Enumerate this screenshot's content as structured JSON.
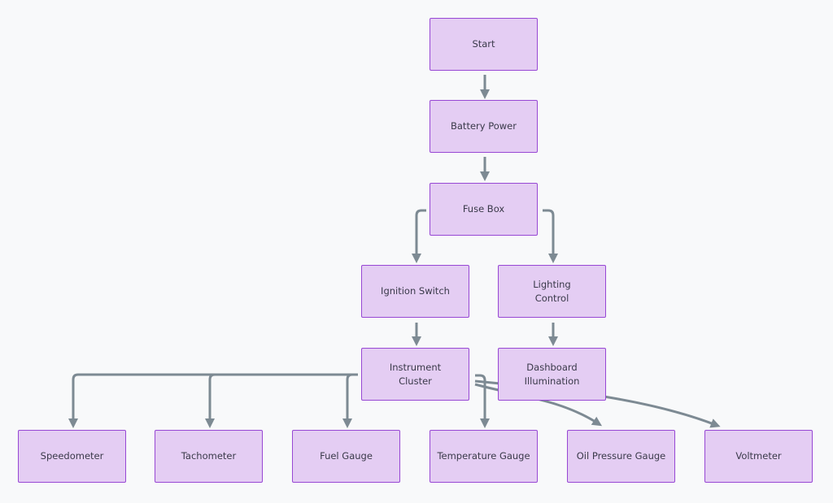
{
  "diagram": {
    "type": "flowchart",
    "direction": "top-down",
    "colors": {
      "background": "#f8f9fa",
      "node_fill": "#e4cdf3",
      "node_border": "#9747d4",
      "edge": "#7d8a93",
      "text": "#3a3a4a"
    },
    "nodes": {
      "start": "Start",
      "battery": "Battery Power",
      "fuse": "Fuse Box",
      "ignition": "Ignition Switch",
      "lighting": "Lighting Control",
      "cluster": "Instrument Cluster",
      "dashboard": "Dashboard Illumination",
      "speedometer": "Speedometer",
      "tachometer": "Tachometer",
      "fuel": "Fuel Gauge",
      "temperature": "Temperature Gauge",
      "oil": "Oil Pressure Gauge",
      "voltmeter": "Voltmeter"
    },
    "edges": [
      [
        "start",
        "battery"
      ],
      [
        "battery",
        "fuse"
      ],
      [
        "fuse",
        "ignition"
      ],
      [
        "fuse",
        "lighting"
      ],
      [
        "ignition",
        "cluster"
      ],
      [
        "lighting",
        "dashboard"
      ],
      [
        "cluster",
        "speedometer"
      ],
      [
        "cluster",
        "tachometer"
      ],
      [
        "cluster",
        "fuel"
      ],
      [
        "cluster",
        "temperature"
      ],
      [
        "cluster",
        "oil"
      ],
      [
        "cluster",
        "voltmeter"
      ]
    ]
  }
}
